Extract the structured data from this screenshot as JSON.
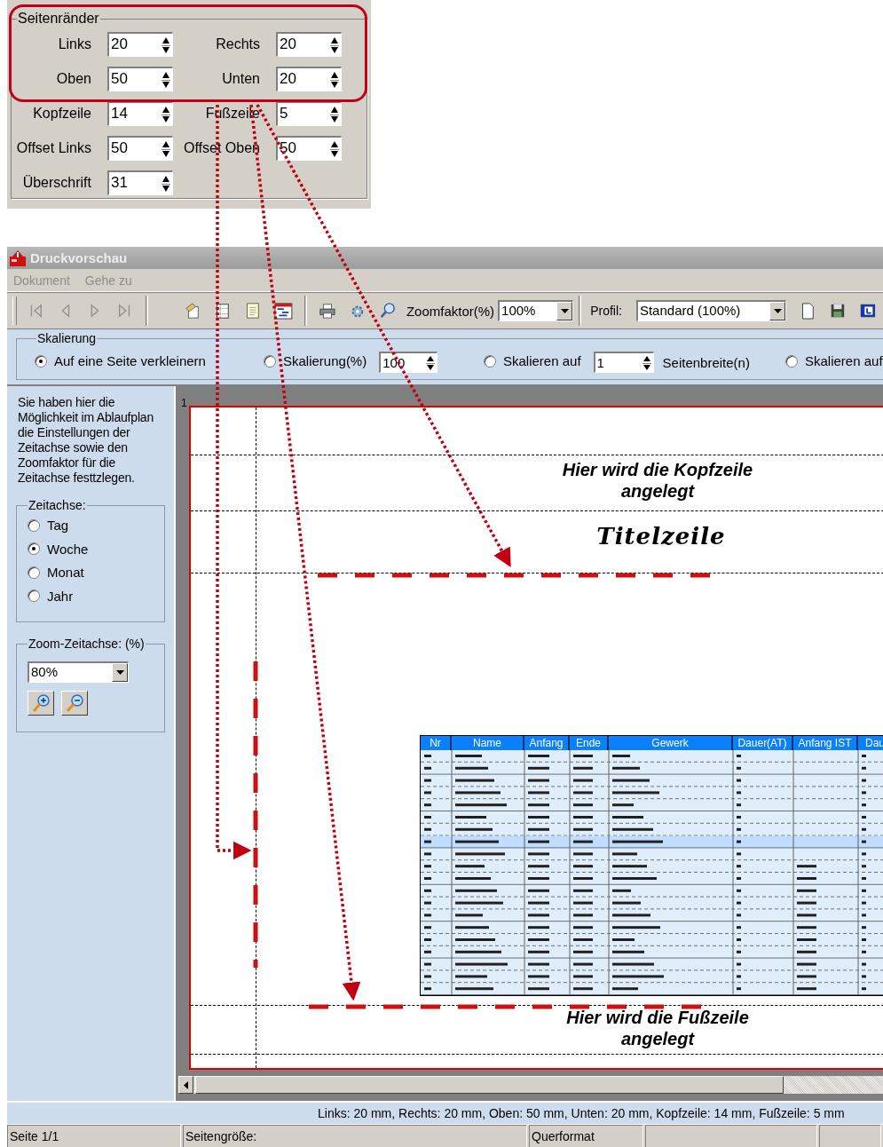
{
  "margins_panel": {
    "title": "Seitenränder",
    "fields": [
      {
        "label": "Links",
        "value": "20"
      },
      {
        "label": "Rechts",
        "value": "20"
      },
      {
        "label": "Oben",
        "value": "50"
      },
      {
        "label": "Unten",
        "value": "20"
      },
      {
        "label": "Kopfzeile",
        "value": "14"
      },
      {
        "label": "Fußzeile",
        "value": "5"
      },
      {
        "label": "Offset Links",
        "value": "50"
      },
      {
        "label": "Offset Oben",
        "value": "50"
      },
      {
        "label": "Überschrift",
        "value": "31"
      }
    ]
  },
  "window": {
    "title": "Druckvorschau"
  },
  "menu": [
    {
      "label": "Dokument",
      "disabled": true
    },
    {
      "label": "Gehe zu",
      "disabled": true
    }
  ],
  "toolbar": {
    "zoom_label": "Zoomfaktor(%)",
    "zoom_value": "100%",
    "profile_label": "Profil:",
    "profile_value": "Standard (100%)"
  },
  "scaling": {
    "title": "Skalierung",
    "options": [
      {
        "label": "Auf eine Seite verkleinern",
        "selected": true
      },
      {
        "label": "Skalierung(%)",
        "selected": false,
        "value": "100"
      },
      {
        "label": "Skalieren auf",
        "selected": false,
        "value": "1",
        "suffix": "Seitenbreite(n)"
      },
      {
        "label": "Skalieren auf",
        "selected": false
      }
    ]
  },
  "sidebar": {
    "description": "Sie haben hier die Möglichkeit im Ablaufplan die Einstellungen der Zeitachse sowie den Zoomfaktor für die Zeitachse festtzlegen.",
    "timeline": {
      "title": "Zeitachse:",
      "options": [
        {
          "label": "Tag",
          "selected": false
        },
        {
          "label": "Woche",
          "selected": true
        },
        {
          "label": "Monat",
          "selected": false
        },
        {
          "label": "Jahr",
          "selected": false
        }
      ]
    },
    "zoom": {
      "title": "Zoom-Zeitachse: (%)",
      "value": "80%"
    }
  },
  "preview": {
    "page_number": "1",
    "header_text": "Hier wird die Kopfzeile angelegt",
    "title_text": "Titelzeile",
    "footer_text": "Hier wird die Fußzeile angelegt",
    "table": {
      "columns": [
        "Nr",
        "Name",
        "Anfang",
        "Ende",
        "Gewerk",
        "Dauer(AT)",
        "Anfang IST",
        "Dau"
      ]
    }
  },
  "margin_summary": "Links: 20 mm, Rechts: 20 mm, Oben: 50 mm, Unten: 20 mm, Kopfzeile: 14 mm, Fußzeile: 5 mm",
  "status_bar": [
    "Seite 1/1",
    "Seitengröße:",
    "Querformat"
  ]
}
